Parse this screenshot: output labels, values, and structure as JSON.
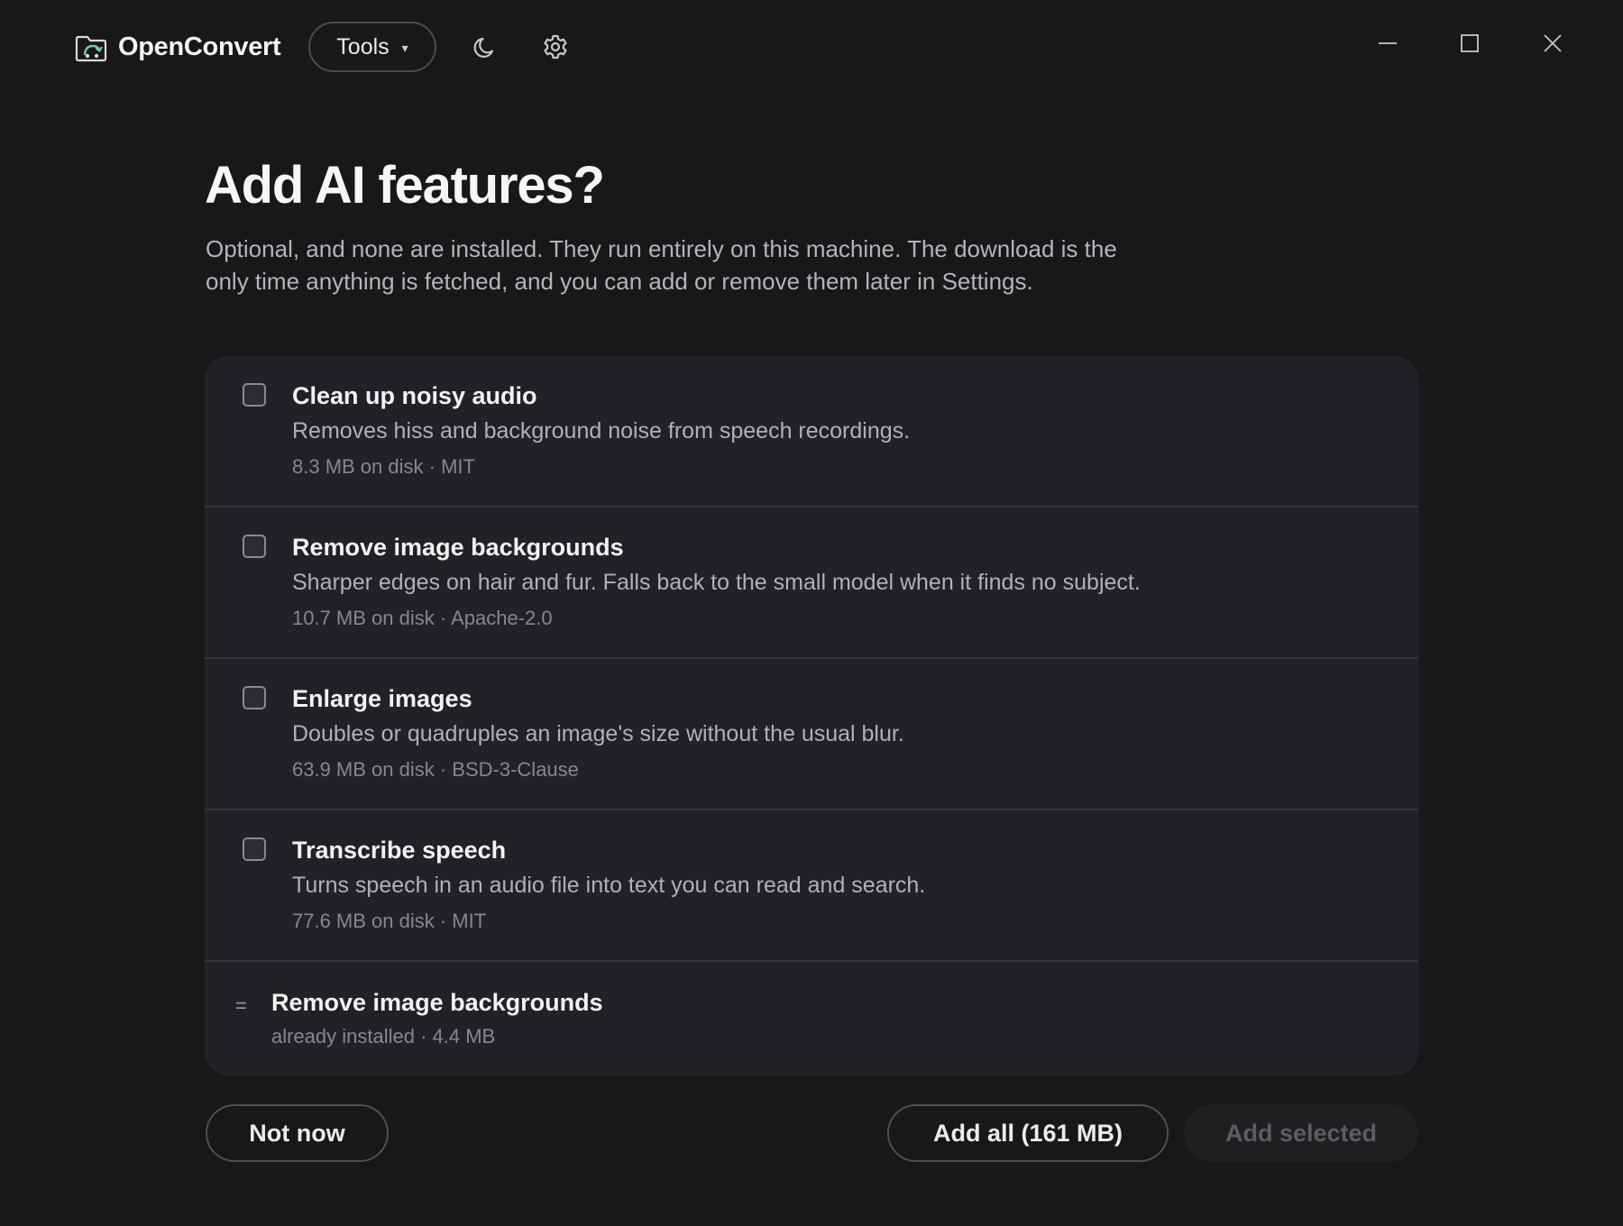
{
  "app": {
    "name": "OpenConvert",
    "logo_icon": "convert-logo-icon",
    "tools_label": "Tools",
    "caret": "▾",
    "theme_icon": "moon-icon",
    "settings_icon": "gear-icon",
    "window_controls": [
      "minimize-icon",
      "maximize-icon",
      "close-icon"
    ]
  },
  "dialog": {
    "title": "Add AI features?",
    "intro": "Optional, and none are installed. They run entirely on this machine. The download is the only time anything is fetched, and you can add or remove them later in Settings.",
    "features": [
      {
        "title": "Clean up noisy audio",
        "description": "Removes hiss and background noise from speech recordings.",
        "meta": "8.3 MB on disk · MIT",
        "checked": false
      },
      {
        "title": "Remove image backgrounds",
        "description": "Sharper edges on hair and fur. Falls back to the small model when it finds no subject.",
        "meta": "10.7 MB on disk · Apache-2.0",
        "checked": false
      },
      {
        "title": "Enlarge images",
        "description": "Doubles or quadruples an image's size without the usual blur.",
        "meta": "63.9 MB on disk · BSD-3-Clause",
        "checked": false
      },
      {
        "title": "Transcribe speech",
        "description": "Turns speech in an audio file into text you can read and search.",
        "meta": "77.6 MB on disk · MIT",
        "checked": false
      }
    ],
    "installed": {
      "mark": "=",
      "title": "Remove image backgrounds",
      "meta": "already installed · 4.4 MB"
    },
    "buttons": {
      "not_now": "Not now",
      "add_all": "Add all (161 MB)",
      "add_selected": "Add selected"
    }
  },
  "colors": {
    "background": "#18181a",
    "card": "#222226",
    "accent_logo": "#6fcfa6"
  }
}
